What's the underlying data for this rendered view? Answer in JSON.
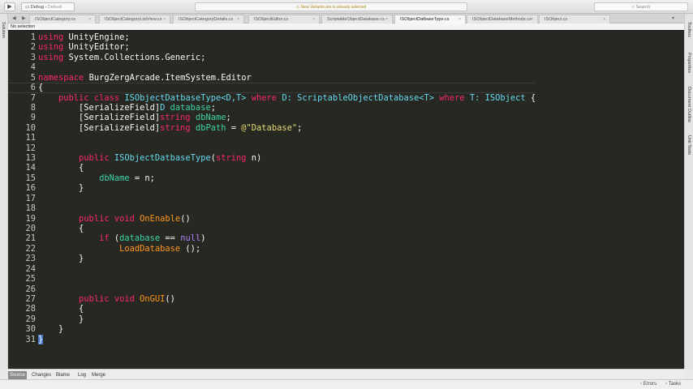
{
  "toolbar": {
    "run_icon": "play-icon",
    "config": "Debug",
    "target": "Default",
    "status_message": "New Variants are is already selected",
    "search_placeholder": "Search"
  },
  "left_pad": {
    "solution_label": "Solution"
  },
  "right_pad": {
    "items": [
      "Toolbox",
      "Properties",
      "Document Outline",
      "Unit Tests"
    ]
  },
  "tabs": [
    {
      "label": "ISObjectCategory.cs"
    },
    {
      "label": "ISObjectCategoryListView.cs"
    },
    {
      "label": "ISObjectCategoryDetails.cs"
    },
    {
      "label": "ISObjectEditor.cs"
    },
    {
      "label": "ScriptableObjectDatabase.cs"
    },
    {
      "label": "ISObjectDatbaseType.cs",
      "active": true
    },
    {
      "label": "ISObjectDatabaseMethods.cs"
    },
    {
      "label": "ISObject.cs"
    }
  ],
  "breadcrumb": "No selection",
  "code": [
    [
      [
        "using",
        "k"
      ],
      [
        " UnityEngine;",
        "p"
      ]
    ],
    [
      [
        "using",
        "k"
      ],
      [
        " UnityEditor;",
        "p"
      ]
    ],
    [
      [
        "using",
        "k"
      ],
      [
        " System.Collections.Generic;",
        "p"
      ]
    ],
    [],
    [
      [
        "namespace",
        "k"
      ],
      [
        " BurgZergArcade.ItemSystem.Editor",
        "p"
      ]
    ],
    [
      [
        "{",
        "p"
      ]
    ],
    [
      [
        "    ",
        "p"
      ],
      [
        "public class",
        "k"
      ],
      [
        " ",
        "p"
      ],
      [
        "ISObjectDatbaseType",
        "ty"
      ],
      [
        "<D,T>",
        "ty"
      ],
      [
        " ",
        "p"
      ],
      [
        "where",
        "k"
      ],
      [
        " D: ",
        "ty"
      ],
      [
        "ScriptableObjectDatabase",
        "ty"
      ],
      [
        "<T>",
        "ty"
      ],
      [
        " ",
        "p"
      ],
      [
        "where",
        "k"
      ],
      [
        " T: ",
        "ty"
      ],
      [
        "ISObject",
        "ty"
      ],
      [
        " {",
        "p"
      ]
    ],
    [
      [
        "        [SerializeField]",
        "p"
      ],
      [
        "D ",
        "ty"
      ],
      [
        "database",
        "id"
      ],
      [
        ";",
        "p"
      ]
    ],
    [
      [
        "        [SerializeField]",
        "p"
      ],
      [
        "string",
        "k"
      ],
      [
        " ",
        "p"
      ],
      [
        "dbName",
        "id"
      ],
      [
        ";",
        "p"
      ]
    ],
    [
      [
        "        [SerializeField]",
        "p"
      ],
      [
        "string",
        "k"
      ],
      [
        " ",
        "p"
      ],
      [
        "dbPath",
        "id"
      ],
      [
        " = ",
        "p"
      ],
      [
        "@\"Database\"",
        "s"
      ],
      [
        ";",
        "p"
      ]
    ],
    [],
    [],
    [
      [
        "        ",
        "p"
      ],
      [
        "public",
        "k"
      ],
      [
        " ",
        "p"
      ],
      [
        "ISObjectDatbaseType",
        "ty"
      ],
      [
        "(",
        "p"
      ],
      [
        "string",
        "k"
      ],
      [
        " n)",
        "p"
      ]
    ],
    [
      [
        "        {",
        "p"
      ]
    ],
    [
      [
        "            ",
        "p"
      ],
      [
        "dbName",
        "id"
      ],
      [
        " = n;",
        "p"
      ]
    ],
    [
      [
        "        }",
        "p"
      ]
    ],
    [],
    [],
    [
      [
        "        ",
        "p"
      ],
      [
        "public void",
        "k"
      ],
      [
        " ",
        "p"
      ],
      [
        "OnEnable",
        "m"
      ],
      [
        "()",
        "p"
      ]
    ],
    [
      [
        "        {",
        "p"
      ]
    ],
    [
      [
        "            ",
        "p"
      ],
      [
        "if",
        "k"
      ],
      [
        " (",
        "p"
      ],
      [
        "database",
        "id"
      ],
      [
        " == ",
        "p"
      ],
      [
        "null",
        "n"
      ],
      [
        ")",
        "p"
      ]
    ],
    [
      [
        "                ",
        "p"
      ],
      [
        "LoadDatabase",
        "m"
      ],
      [
        " ();",
        "p"
      ]
    ],
    [
      [
        "        }",
        "p"
      ]
    ],
    [],
    [],
    [],
    [
      [
        "        ",
        "p"
      ],
      [
        "public void",
        "k"
      ],
      [
        " ",
        "p"
      ],
      [
        "OnGUI",
        "m"
      ],
      [
        "()",
        "p"
      ]
    ],
    [
      [
        "        {",
        "p"
      ]
    ],
    [
      [
        "        }",
        "p"
      ]
    ],
    [
      [
        "    }",
        "p"
      ]
    ],
    [
      [
        "}",
        "cursor"
      ]
    ]
  ],
  "bottom_tabs": [
    "Source",
    "Changes",
    "Blame",
    "Log",
    "Merge"
  ],
  "status": {
    "errors": "Errors",
    "tasks": "Tasks"
  }
}
